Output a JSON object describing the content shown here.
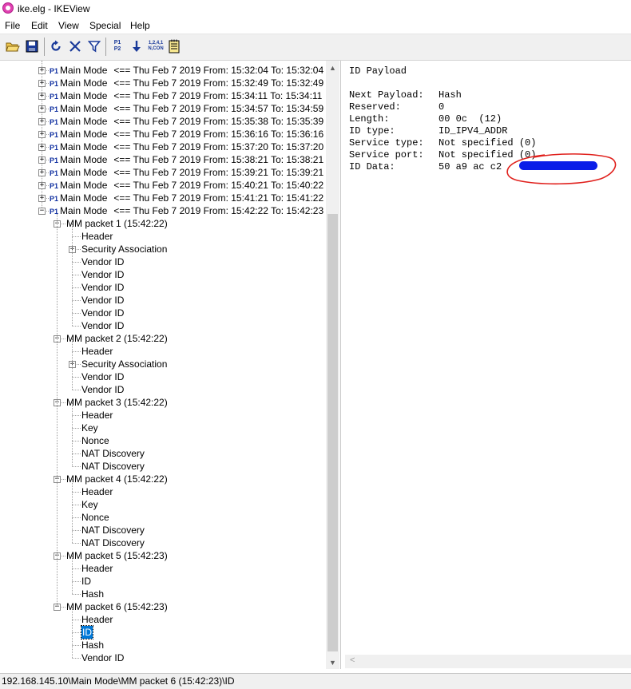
{
  "window": {
    "title": "ike.elg - IKEView"
  },
  "menu": [
    "File",
    "Edit",
    "View",
    "Special",
    "Help"
  ],
  "toolbar": {
    "buttons": [
      "open-icon",
      "save-icon",
      "refresh-icon",
      "delete-icon",
      "filter-icon",
      "p1-p2-icon",
      "down-arrow-icon",
      "counter-icon",
      "notepad-icon"
    ],
    "p1": "P1",
    "p2": "P2",
    "counter_top": "1,2,4,1",
    "counter_bottom": "N,CON"
  },
  "tree": {
    "p1_badge": "P1",
    "main_modes": [
      {
        "label": "Main Mode",
        "text": "<== Thu Feb 7 2019 From: 15:32:04 To: 15:32:04"
      },
      {
        "label": "Main Mode",
        "text": "<== Thu Feb 7 2019 From: 15:32:49 To: 15:32:49"
      },
      {
        "label": "Main Mode",
        "text": "<== Thu Feb 7 2019 From: 15:34:11 To: 15:34:11"
      },
      {
        "label": "Main Mode",
        "text": "<== Thu Feb 7 2019 From: 15:34:57 To: 15:34:59"
      },
      {
        "label": "Main Mode",
        "text": "<== Thu Feb 7 2019 From: 15:35:38 To: 15:35:39"
      },
      {
        "label": "Main Mode",
        "text": "<== Thu Feb 7 2019 From: 15:36:16 To: 15:36:16"
      },
      {
        "label": "Main Mode",
        "text": "<== Thu Feb 7 2019 From: 15:37:20 To: 15:37:20"
      },
      {
        "label": "Main Mode",
        "text": "<== Thu Feb 7 2019 From: 15:38:21 To: 15:38:21"
      },
      {
        "label": "Main Mode",
        "text": "<== Thu Feb 7 2019 From: 15:39:21 To: 15:39:21"
      },
      {
        "label": "Main Mode",
        "text": "<== Thu Feb 7 2019 From: 15:40:21 To: 15:40:22"
      },
      {
        "label": "Main Mode",
        "text": "<== Thu Feb 7 2019 From: 15:41:21 To: 15:41:22"
      },
      {
        "label": "Main Mode",
        "text": "<== Thu Feb 7 2019 From: 15:42:22 To: 15:42:23"
      }
    ],
    "packets": [
      {
        "label": "MM packet 1 (15:42:22)",
        "children": [
          "Header",
          "Security Association",
          "Vendor ID",
          "Vendor ID",
          "Vendor ID",
          "Vendor ID",
          "Vendor ID",
          "Vendor ID"
        ]
      },
      {
        "label": "MM packet 2 (15:42:22)",
        "children": [
          "Header",
          "Security Association",
          "Vendor ID",
          "Vendor ID"
        ]
      },
      {
        "label": "MM packet 3 (15:42:22)",
        "children": [
          "Header",
          "Key",
          "Nonce",
          "NAT Discovery",
          "NAT Discovery"
        ]
      },
      {
        "label": "MM packet 4 (15:42:22)",
        "children": [
          "Header",
          "Key",
          "Nonce",
          "NAT Discovery",
          "NAT Discovery"
        ]
      },
      {
        "label": "MM packet 5 (15:42:23)",
        "children": [
          "Header",
          "ID",
          "Hash"
        ]
      },
      {
        "label": "MM packet 6 (15:42:23)",
        "children": [
          "Header",
          "ID",
          "Hash",
          "Vendor ID"
        ]
      }
    ],
    "expandable_children": [
      "Security Association"
    ],
    "selected": {
      "packet": 5,
      "child": 1
    }
  },
  "detail": {
    "heading": "ID Payload",
    "fields": [
      {
        "name": "Next Payload:",
        "value": "Hash"
      },
      {
        "name": "Reserved:",
        "value": "0"
      },
      {
        "name": "Length:",
        "value": "00 0c  (12)"
      },
      {
        "name": "ID type:",
        "value": "ID_IPV4_ADDR"
      },
      {
        "name": "Service type:",
        "value": "Not specified (0)"
      },
      {
        "name": "Service port:",
        "value": "Not specified (0)"
      },
      {
        "name": "ID Data:",
        "value": "50 a9 ac c2"
      }
    ],
    "redaction_color": "#0a1ee8",
    "annotation_color": "#e0201c"
  },
  "status": {
    "path": "192.168.145.10\\Main Mode\\MM packet 6 (15:42:23)\\ID"
  }
}
